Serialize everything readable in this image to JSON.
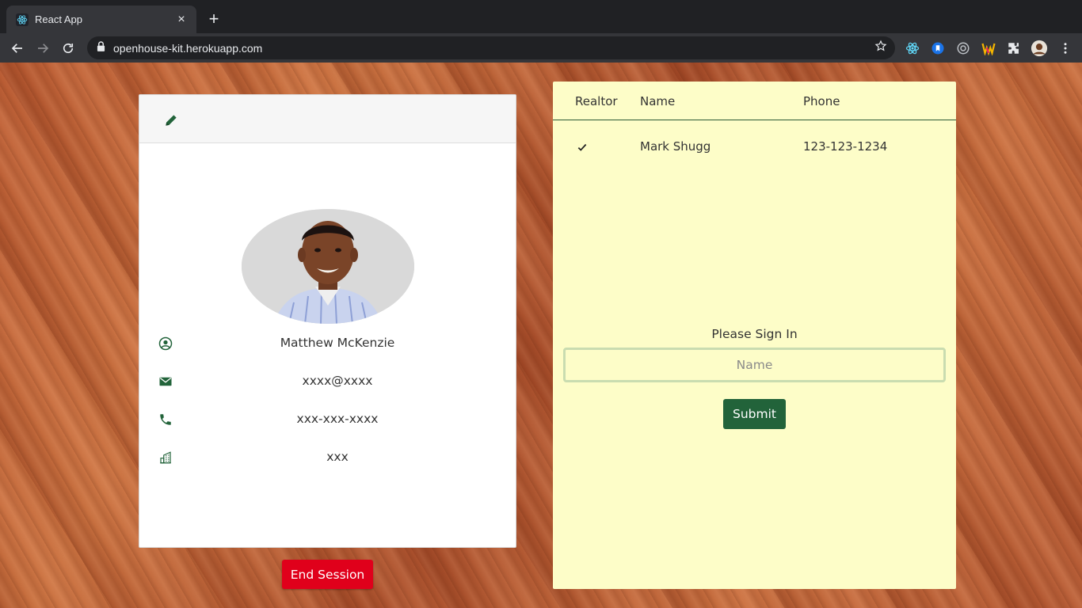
{
  "browser": {
    "tab_title": "React App",
    "url": "openhouse-kit.herokuapp.com"
  },
  "profile": {
    "name": "Matthew McKenzie",
    "email": "xxxx@xxxx",
    "phone": "xxx-xxx-xxxx",
    "company": "xxx",
    "end_session_label": "End Session"
  },
  "signin": {
    "columns": [
      "Realtor",
      "Name",
      "Phone"
    ],
    "rows": [
      {
        "realtor": true,
        "name": "Mark Shugg",
        "phone": "123-123-1234"
      }
    ],
    "prompt": "Please Sign In",
    "input_placeholder": "Name",
    "submit_label": "Submit"
  },
  "colors": {
    "brand_green": "#22633a",
    "end_session_red": "#e0001b",
    "signin_background": "#fdfdc8"
  }
}
